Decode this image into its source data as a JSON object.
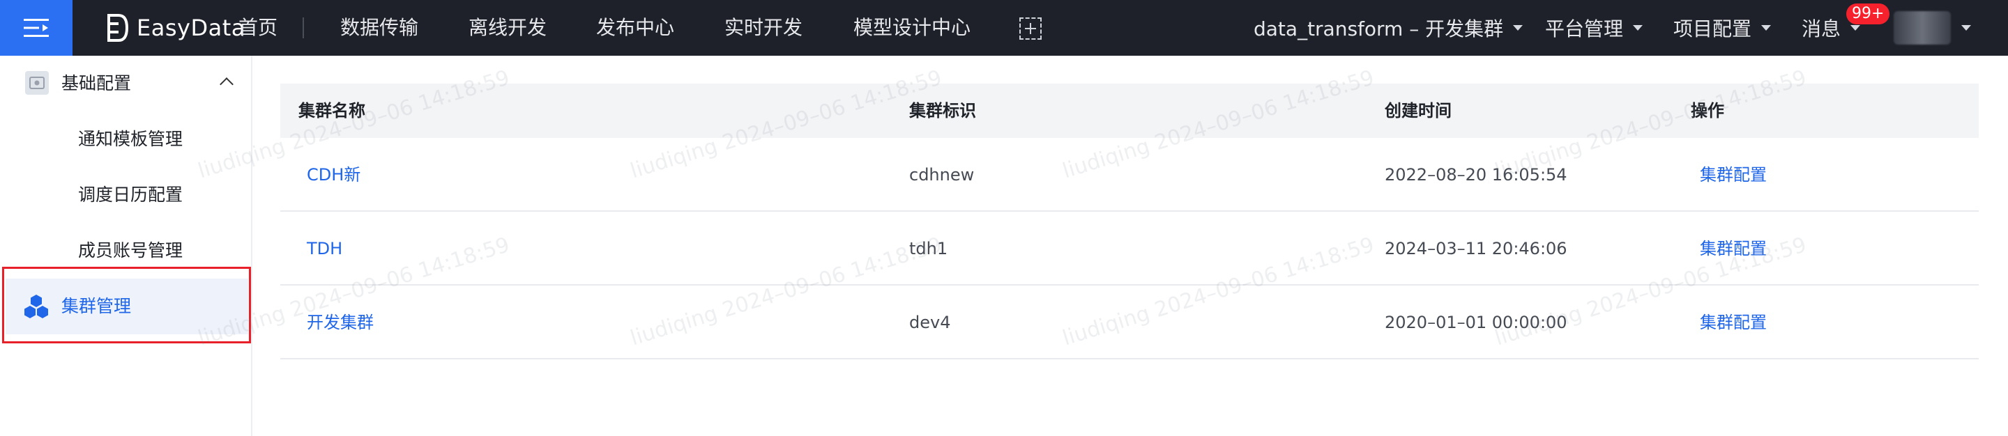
{
  "header": {
    "logo_text": "EasyData",
    "nav": [
      "首页",
      "数据传输",
      "离线开发",
      "发布中心",
      "实时开发",
      "模型设计中心"
    ],
    "project_selector": "data_transform – 开发集群",
    "platform_menu": "平台管理",
    "project_config_menu": "项目配置",
    "messages_label": "消息",
    "messages_badge": "99+"
  },
  "sidebar": {
    "group_label": "基础配置",
    "items": [
      {
        "label": "通知模板管理"
      },
      {
        "label": "调度日历配置"
      },
      {
        "label": "成员账号管理"
      },
      {
        "label": "集群管理",
        "active": true
      }
    ]
  },
  "table": {
    "columns": [
      "集群名称",
      "集群标识",
      "创建时间",
      "操作"
    ],
    "rows": [
      {
        "name": "CDH新",
        "id": "cdhnew",
        "created": "2022–08–20 16:05:54",
        "action": "集群配置"
      },
      {
        "name": "TDH",
        "id": "tdh1",
        "created": "2024–03–11 20:46:06",
        "action": "集群配置"
      },
      {
        "name": "开发集群",
        "id": "dev4",
        "created": "2020–01–01 00:00:00",
        "action": "集群配置"
      }
    ]
  },
  "watermark": "liudiqing 2024–09–06 14:18:59",
  "colors": {
    "topbar_bg": "#1e2129",
    "accent_blue": "#2b6ff2",
    "link_blue": "#1f66e8",
    "highlight_red": "#e8202a",
    "badge_red": "#f5222d"
  }
}
